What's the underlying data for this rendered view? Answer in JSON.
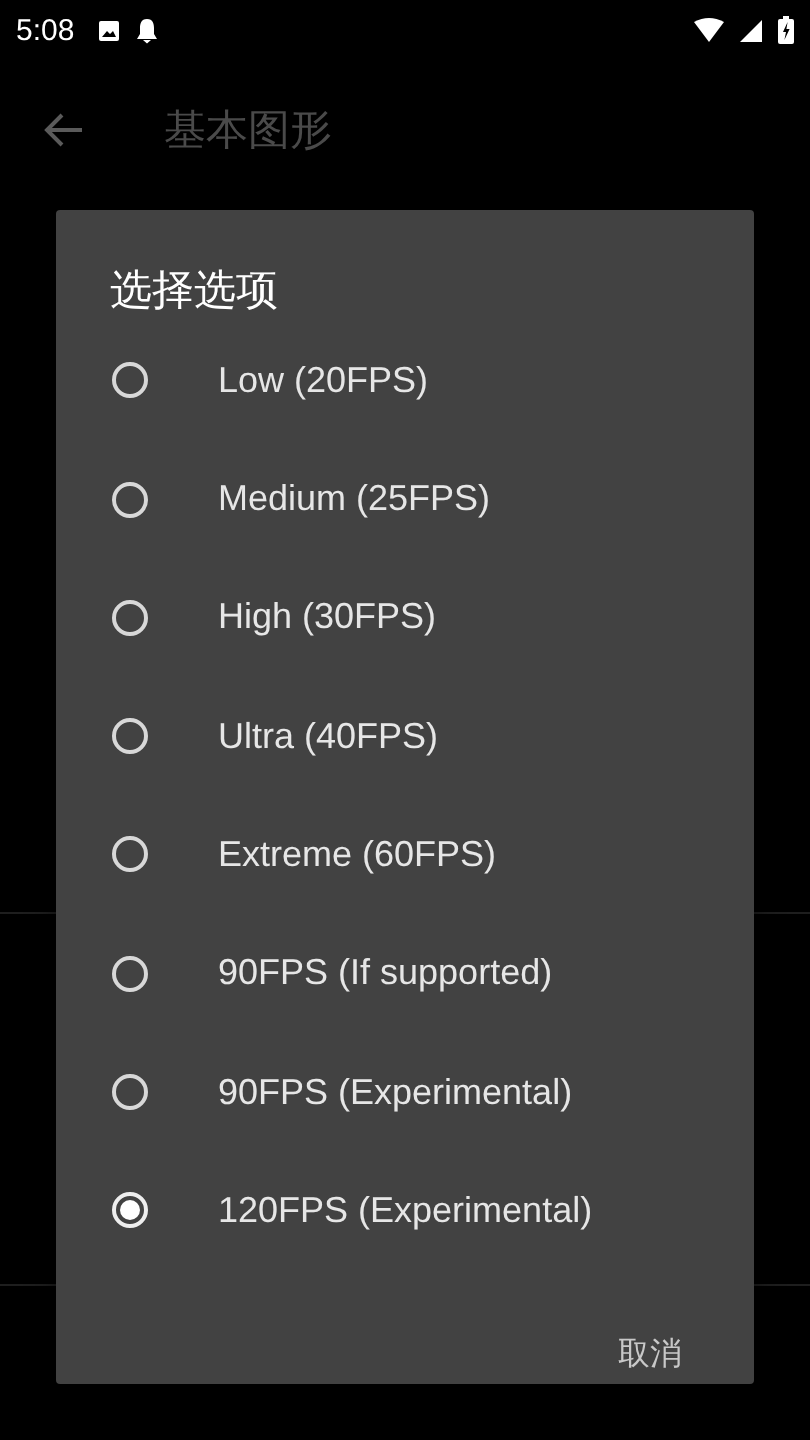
{
  "status_bar": {
    "time": "5:08"
  },
  "app_bar": {
    "title": "基本图形"
  },
  "dialog": {
    "title": "选择选项",
    "options": [
      {
        "label": "Low (20FPS)",
        "selected": false
      },
      {
        "label": "Medium (25FPS)",
        "selected": false
      },
      {
        "label": "High (30FPS)",
        "selected": false
      },
      {
        "label": "Ultra (40FPS)",
        "selected": false
      },
      {
        "label": "Extreme (60FPS)",
        "selected": false
      },
      {
        "label": "90FPS (If supported)",
        "selected": false
      },
      {
        "label": "90FPS (Experimental)",
        "selected": false
      },
      {
        "label": "120FPS (Experimental)",
        "selected": true
      }
    ],
    "cancel": "取消"
  }
}
